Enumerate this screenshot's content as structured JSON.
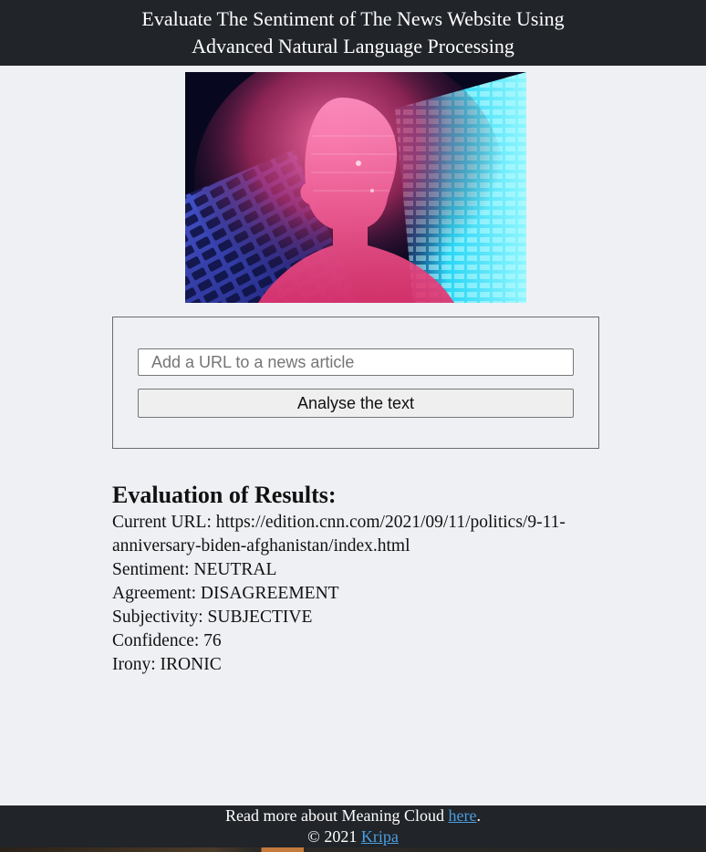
{
  "header": {
    "title_line1": "Evaluate The Sentiment of The News Website Using",
    "title_line2": "Advanced Natural Language Processing"
  },
  "hero": {
    "icon": "ai-head-illustration"
  },
  "form": {
    "url_placeholder": "Add a URL to a news article",
    "url_value": "",
    "submit_label": "Analyse the text"
  },
  "results": {
    "heading": "Evaluation of Results:",
    "url_line": "Current URL: https://edition.cnn.com/2021/09/11/politics/9-11-anniversary-biden-afghanistan/index.html",
    "sentiment_line": "Sentiment: NEUTRAL",
    "agreement_line": "Agreement: DISAGREEMENT",
    "subjectivity_line": "Subjectivity: SUBJECTIVE",
    "confidence_line": "Confidence: 76",
    "irony_line": "Irony: IRONIC"
  },
  "footer": {
    "read_more_prefix": "Read more about Meaning Cloud ",
    "read_more_link": "here",
    "read_more_suffix": ".",
    "copyright_prefix": "© 2021 ",
    "author_link": "Kripa"
  },
  "colors": {
    "header_bg": "#212429",
    "page_bg": "#eef0f4",
    "link": "#4a9fe0"
  }
}
